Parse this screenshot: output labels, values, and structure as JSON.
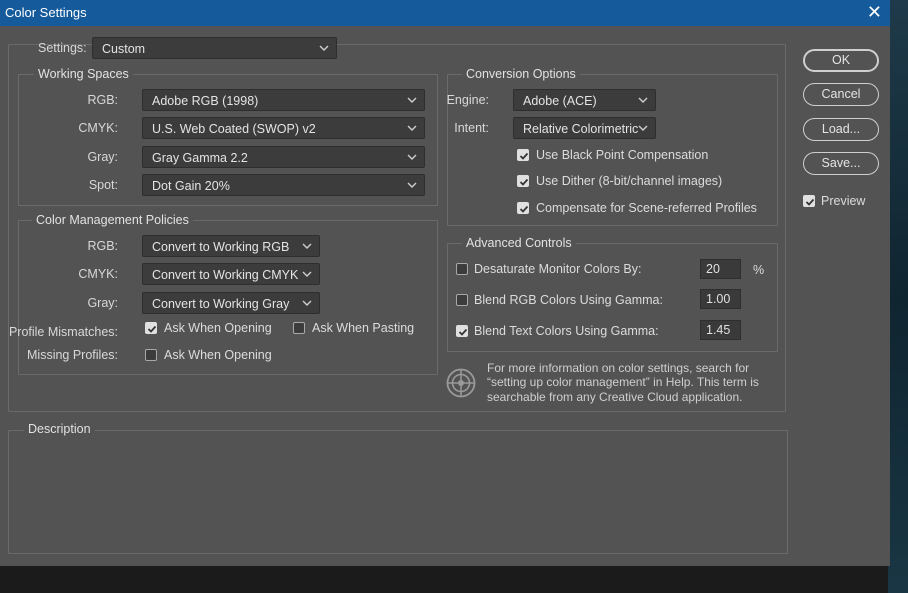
{
  "window": {
    "title": "Color Settings",
    "close_glyph": "✕"
  },
  "settings": {
    "label": "Settings:",
    "value": "Custom"
  },
  "working_spaces": {
    "title": "Working Spaces",
    "rgb_label": "RGB:",
    "rgb_value": "Adobe RGB (1998)",
    "cmyk_label": "CMYK:",
    "cmyk_value": "U.S. Web Coated (SWOP) v2",
    "gray_label": "Gray:",
    "gray_value": "Gray Gamma 2.2",
    "spot_label": "Spot:",
    "spot_value": "Dot Gain 20%"
  },
  "policies": {
    "title": "Color Management Policies",
    "rgb_label": "RGB:",
    "rgb_value": "Convert to Working RGB",
    "cmyk_label": "CMYK:",
    "cmyk_value": "Convert to Working CMYK",
    "gray_label": "Gray:",
    "gray_value": "Convert to Working Gray",
    "mismatch_label": "Profile Mismatches:",
    "mismatch_opening": {
      "label": "Ask When Opening",
      "checked": true
    },
    "mismatch_pasting": {
      "label": "Ask When Pasting",
      "checked": false
    },
    "missing_label": "Missing Profiles:",
    "missing_opening": {
      "label": "Ask When Opening",
      "checked": false
    }
  },
  "conversion": {
    "title": "Conversion Options",
    "engine_label": "Engine:",
    "engine_value": "Adobe (ACE)",
    "intent_label": "Intent:",
    "intent_value": "Relative Colorimetric",
    "black_point": {
      "label": "Use Black Point Compensation",
      "checked": true
    },
    "dither": {
      "label": "Use Dither (8-bit/channel images)",
      "checked": true
    },
    "scene": {
      "label": "Compensate for Scene-referred Profiles",
      "checked": true
    }
  },
  "advanced": {
    "title": "Advanced Controls",
    "desaturate": {
      "label": "Desaturate Monitor Colors By:",
      "checked": false,
      "value": "20",
      "unit": "%"
    },
    "blend_rgb": {
      "label": "Blend RGB Colors Using Gamma:",
      "checked": false,
      "value": "1.00"
    },
    "blend_text": {
      "label": "Blend Text Colors Using Gamma:",
      "checked": true,
      "value": "1.45"
    }
  },
  "info": {
    "icon": "color-wheel-icon",
    "line1": "For more information on color settings, search for",
    "line2": "“setting up color management” in Help. This term is",
    "line3": "searchable from any Creative Cloud application."
  },
  "description": {
    "title": "Description"
  },
  "buttons": {
    "ok": "OK",
    "cancel": "Cancel",
    "load": "Load...",
    "save": "Save..."
  },
  "preview": {
    "label": "Preview",
    "checked": true
  }
}
